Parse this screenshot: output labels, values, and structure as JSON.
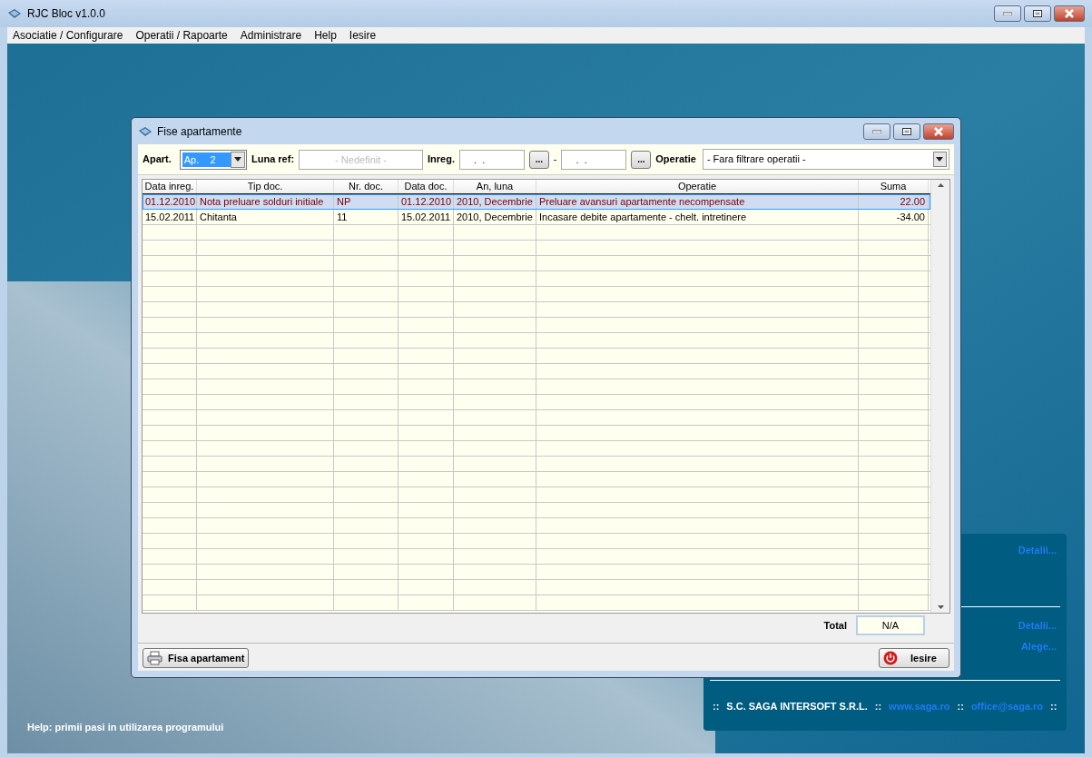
{
  "window": {
    "title": "RJC Bloc v1.0.0"
  },
  "menu": [
    "Asociatie / Configurare",
    "Operatii / Rapoarte",
    "Administrare",
    "Help",
    "Iesire"
  ],
  "dialog": {
    "title": "Fise apartamente",
    "filters": {
      "apart_label": "Apart.",
      "apart_value": "Ap.    2",
      "luna_label": "Luna ref:",
      "luna_placeholder": "- Nedefinit -",
      "inreg_label": "Inreg.",
      "date_from": " .  .",
      "browse_from": "...",
      "separator": "-",
      "date_to": " .  .",
      "browse_to": "...",
      "operatie_label": "Operatie",
      "operatie_value": "- Fara filtrare operatii -"
    },
    "table": {
      "columns": [
        "Data inreg.",
        "Tip doc.",
        "Nr. doc.",
        "Data doc.",
        "An, luna",
        "Operatie",
        "Suma"
      ],
      "rows": [
        {
          "cells": [
            "01.12.2010",
            "Nota preluare solduri initiale",
            "NP",
            "01.12.2010",
            "2010, Decembrie",
            "Preluare avansuri apartamente necompensate",
            "22.00"
          ],
          "selected": true
        },
        {
          "cells": [
            "15.02.2011",
            "Chitanta",
            "11",
            "15.02.2011",
            "2010, Decembrie",
            "Incasare debite apartamente - chelt. intretinere",
            "-34.00"
          ],
          "selected": false
        }
      ]
    },
    "total_label": "Total",
    "total_value": "N/A",
    "buttons": [
      "Fisa apartament",
      "Iesire"
    ]
  },
  "info_panel": {
    "links_top": [
      "Detalii..."
    ],
    "links_middle": [
      "Detalii...",
      "Alege..."
    ],
    "footer": [
      {
        "kind": "sep",
        "text": "::"
      },
      {
        "kind": "text",
        "text": "S.C. SAGA INTERSOFT S.R.L."
      },
      {
        "kind": "sep",
        "text": "::"
      },
      {
        "kind": "link",
        "text": "www.saga.ro"
      },
      {
        "kind": "sep",
        "text": "::"
      },
      {
        "kind": "link",
        "text": "office@saga.ro"
      },
      {
        "kind": "sep",
        "text": "::"
      }
    ]
  },
  "help_text": "Help: primii pasi in utilizarea programului"
}
